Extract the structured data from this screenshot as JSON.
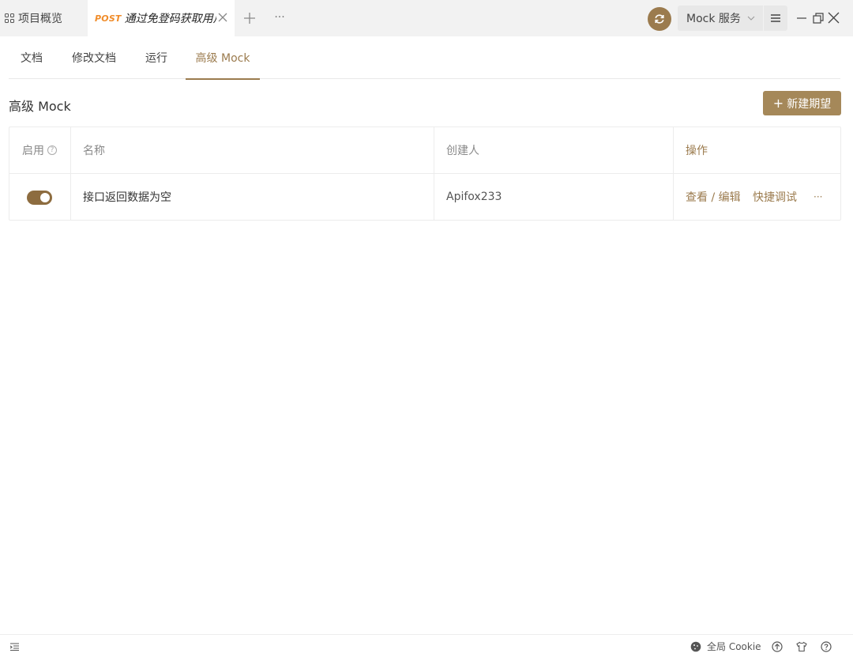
{
  "topbar": {
    "overview_tab": "项目概览",
    "active_tab": {
      "method": "POST",
      "title": "通过免登码获取用户信息"
    },
    "mock_service": "Mock 服务"
  },
  "subtabs": [
    {
      "label": "文档"
    },
    {
      "label": "修改文档"
    },
    {
      "label": "运行"
    },
    {
      "label": "高级 Mock",
      "active": true
    }
  ],
  "section": {
    "title": "高级 Mock",
    "new_button": "新建期望"
  },
  "table": {
    "headers": {
      "enabled": "启用",
      "name": "名称",
      "creator": "创建人",
      "actions": "操作"
    },
    "rows": [
      {
        "enabled": true,
        "name": "接口返回数据为空",
        "creator": "Apifox233",
        "view_edit": "查看 / 编辑",
        "quick_debug": "快捷调试",
        "more": "···"
      }
    ]
  },
  "footer": {
    "cookie_label": "全局 Cookie"
  },
  "colors": {
    "accent": "#9b7b4e",
    "button": "#a58859",
    "method_post": "#f08c2a"
  }
}
